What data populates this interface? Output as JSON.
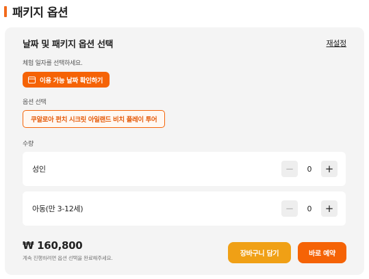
{
  "section": {
    "title": "패키지 옵션"
  },
  "panel": {
    "title": "날짜 및 패키지 옵션 선택",
    "reset_label": "재설정"
  },
  "date": {
    "label": "체험 일자를 선택하세요.",
    "button_label": "이용 가능 날짜 확인하기"
  },
  "option": {
    "label": "옵션 선택",
    "selected": "쿠알로아 펀치 시크릿 아일랜드 비치 플레이 투어"
  },
  "quantity": {
    "label": "수량",
    "rows": [
      {
        "name": "성인",
        "value": "0"
      },
      {
        "name": "아동(만 3-12세)",
        "value": "0"
      }
    ]
  },
  "footer": {
    "price": "₩ 160,800",
    "note": "계속 진행하려면 옵션 선택을 완료해주세요.",
    "cart_label": "장바구니 담기",
    "buy_label": "바로 예약"
  },
  "colors": {
    "accent": "#f56306",
    "cart": "#f0a015",
    "panel_bg": "#f4f4f4"
  },
  "icons": {
    "date_button": "calendar-icon",
    "decrement": "minus-icon",
    "increment": "plus-icon"
  }
}
